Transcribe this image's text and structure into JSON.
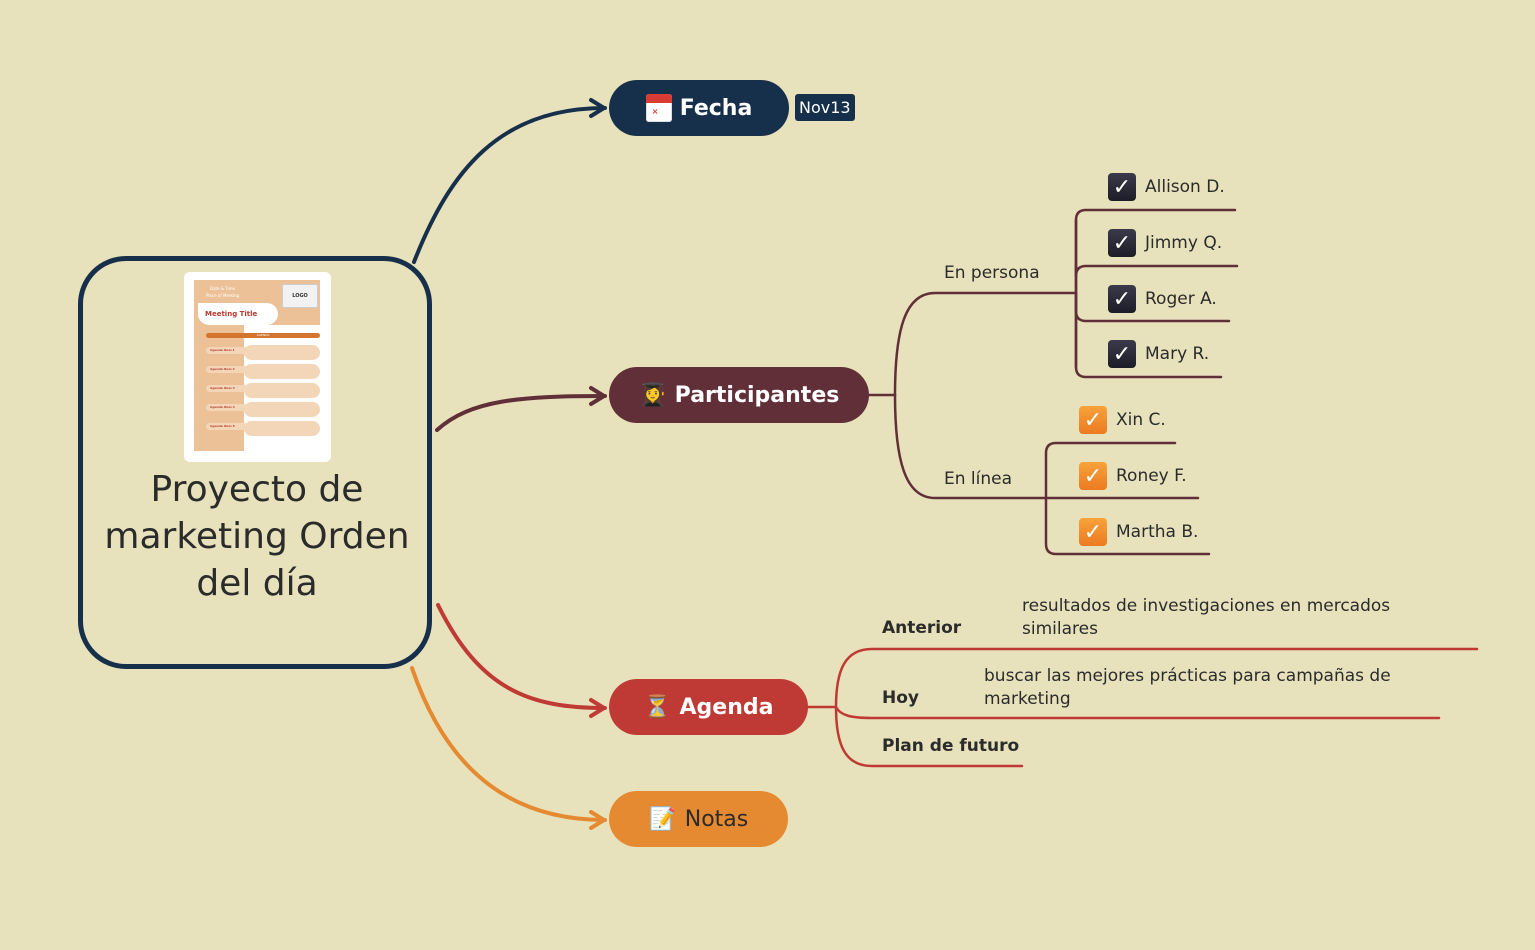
{
  "colors": {
    "background": "#e7e1bc",
    "fecha": "#16304b",
    "participantes": "#612f38",
    "agenda": "#c03a35",
    "notas": "#e58a30",
    "check_dark": "#24242f",
    "check_orange": "#f08d2c"
  },
  "root": {
    "title": "Proyecto de marketing Orden del día",
    "thumbnail": {
      "date_time": "Date & Time",
      "place": "Place of Meeting",
      "logo": "LOGO",
      "meeting_title": "Meeting Title",
      "agenda_bar": "AGENDA",
      "items": [
        "Agenda Item 1",
        "Agenda Item 2",
        "Agenda Item 3",
        "Agenda Item 4",
        "Agenda Item 5"
      ]
    }
  },
  "topics": {
    "fecha": {
      "label": "Fecha",
      "icon": "calendar-icon",
      "badge": "Nov13"
    },
    "participantes": {
      "label": "Participantes",
      "icon": "student-icon",
      "emoji": "👩‍🎓",
      "groups": [
        {
          "label": "En persona",
          "check_style": "dark",
          "people": [
            "Allison D.",
            "Jimmy Q.",
            "Roger A.",
            "Mary R."
          ]
        },
        {
          "label": "En línea",
          "check_style": "orange",
          "people": [
            "Xin C.",
            "Roney F.",
            "Martha B."
          ]
        }
      ]
    },
    "agenda": {
      "label": "Agenda",
      "icon": "hourglass-icon",
      "emoji": "⏳",
      "items": [
        {
          "label": "Anterior",
          "detail": "resultados de investigaciones en mercados similares"
        },
        {
          "label": "Hoy",
          "detail": "buscar las mejores prácticas para campañas de marketing"
        },
        {
          "label": "Plan de futuro",
          "detail": ""
        }
      ]
    },
    "notas": {
      "label": "Notas",
      "icon": "memo-icon",
      "emoji": "📝"
    }
  },
  "check_glyph": "✓"
}
